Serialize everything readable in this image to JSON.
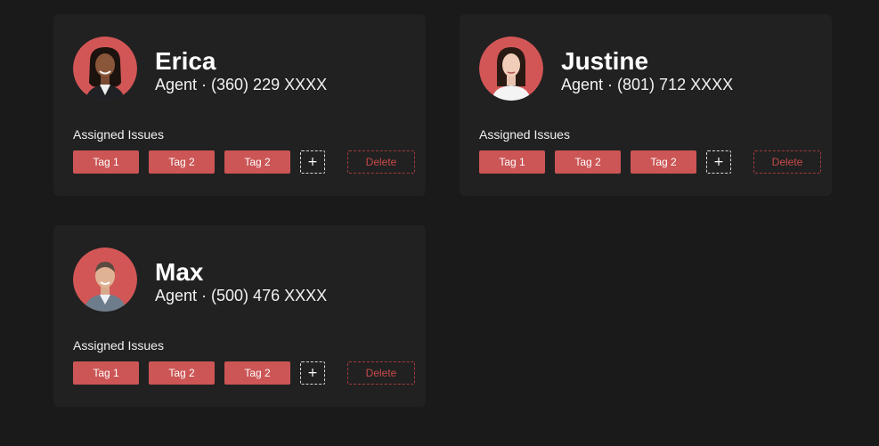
{
  "colors": {
    "page_background": "#1a1a1a",
    "card_background": "#212121",
    "accent": "#cc5555",
    "delete": "#c84a4a"
  },
  "section_label": "Assigned Issues",
  "add_label": "+",
  "delete_label": "Delete",
  "cards": [
    {
      "name": "Erica",
      "subtitle": "Agent · (360) 229 XXXX",
      "tags": [
        "Tag 1",
        "Tag 2",
        "Tag 2"
      ]
    },
    {
      "name": "Justine",
      "subtitle": "Agent · (801) 712 XXXX",
      "tags": [
        "Tag 1",
        "Tag 2",
        "Tag 2"
      ]
    },
    {
      "name": "Max",
      "subtitle": "Agent · (500) 476 XXXX",
      "tags": [
        "Tag 1",
        "Tag 2",
        "Tag 2"
      ]
    }
  ]
}
